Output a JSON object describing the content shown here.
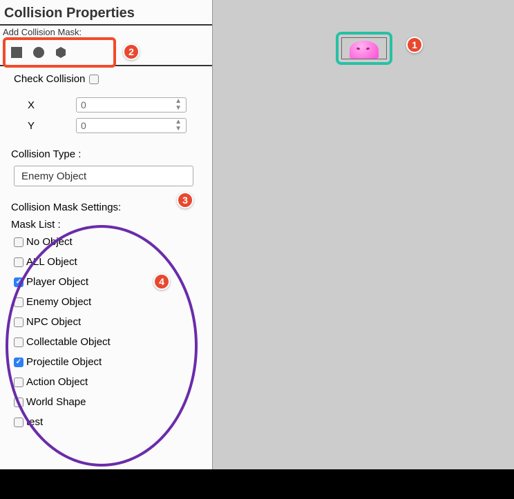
{
  "panel_title": "Collision Properties",
  "add_mask_label": "Add Collision Mask:",
  "shapes": [
    "square",
    "circle",
    "hexagon"
  ],
  "check_collision_label": "Check Collision",
  "check_collision_checked": false,
  "x": {
    "label": "X",
    "value": "0"
  },
  "y": {
    "label": "Y",
    "value": "0"
  },
  "collision_type_label": "Collision Type :",
  "collision_type_value": "Enemy Object",
  "mask_settings_label": "Collision Mask Settings:",
  "mask_list_label": "Mask List :",
  "mask_list": [
    {
      "label": "No Object",
      "checked": false
    },
    {
      "label": "ALL Object",
      "checked": false
    },
    {
      "label": "Player Object",
      "checked": true
    },
    {
      "label": "Enemy Object",
      "checked": false
    },
    {
      "label": "NPC Object",
      "checked": false
    },
    {
      "label": "Collectable Object",
      "checked": false
    },
    {
      "label": "Projectile Object",
      "checked": true
    },
    {
      "label": "Action Object",
      "checked": false
    },
    {
      "label": "World Shape",
      "checked": false
    },
    {
      "label": "test",
      "checked": false
    }
  ],
  "callouts": {
    "c1": "1",
    "c2": "2",
    "c3": "3",
    "c4": "4"
  },
  "colors": {
    "accent_red": "#e8482f",
    "teal": "#26c1a6",
    "purple": "#6a2caa",
    "check_blue": "#2d7ef7"
  }
}
